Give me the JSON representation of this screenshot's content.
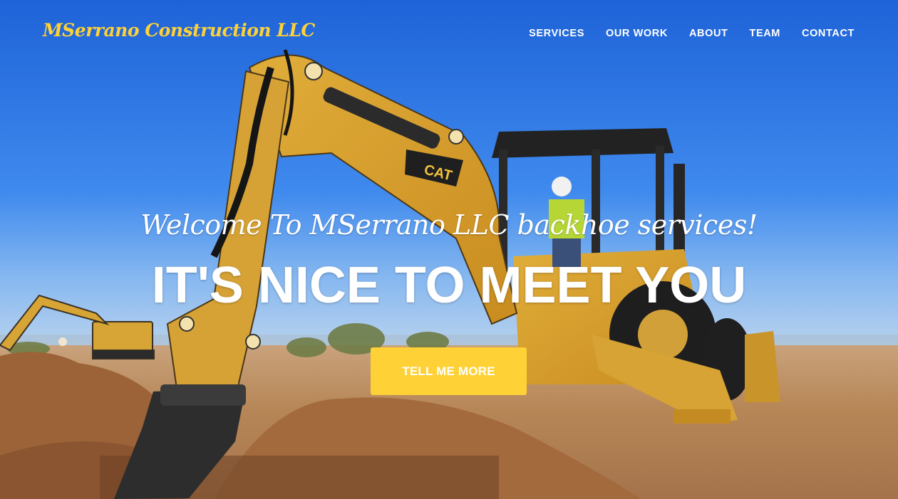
{
  "brand": {
    "name": "MSerrano Construction LLC"
  },
  "nav": {
    "items": [
      {
        "label": "SERVICES"
      },
      {
        "label": "OUR WORK"
      },
      {
        "label": "ABOUT"
      },
      {
        "label": "TEAM"
      },
      {
        "label": "CONTACT"
      }
    ]
  },
  "intro": {
    "lead_in": "Welcome To MSerrano LLC backhoe services!",
    "heading": "IT'S NICE TO MEET YOU",
    "button_label": "TELL ME MORE"
  },
  "colors": {
    "accent": "#fed136",
    "sky": "#2f76e4",
    "ground": "#b98a5e",
    "text": "#ffffff"
  },
  "hero_image": {
    "subject": "backhoe-loader",
    "brand_mark": "CAT"
  }
}
